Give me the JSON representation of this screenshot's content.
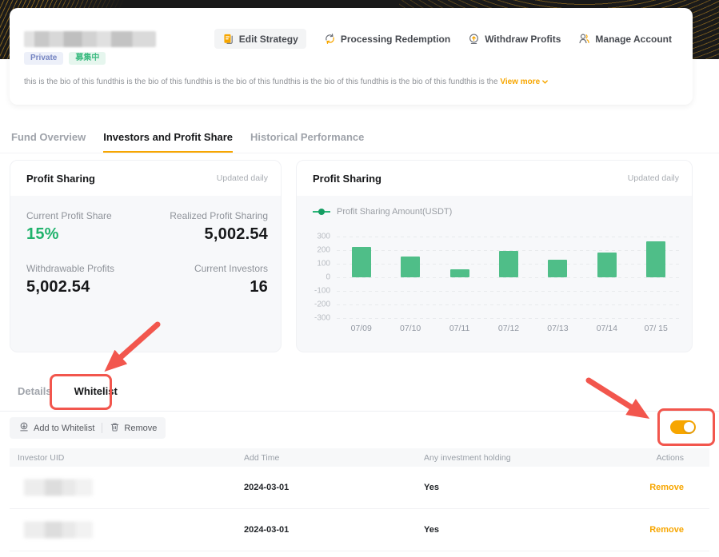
{
  "colors": {
    "accent": "#F7A600",
    "green": "#20B26C",
    "bar_green": "#4FBE88",
    "annotation_red": "#F2564D"
  },
  "header": {
    "badges": [
      {
        "label": "Private",
        "style": "blue"
      },
      {
        "label": "募集中",
        "style": "green"
      }
    ],
    "bio": "this is the bio of this fundthis is the bio of this fundthis is the bio of this fundthis is the bio of this fundthis is the bio of this fundthis is the ",
    "view_more": "View more",
    "actions": [
      {
        "label": "Edit Strategy",
        "icon": "edit-strategy-icon",
        "name": "edit-strategy",
        "pill": true
      },
      {
        "label": "Processing Redemption",
        "icon": "processing-redemption-icon",
        "name": "processing-redemption",
        "pill": false
      },
      {
        "label": "Withdraw Profits",
        "icon": "withdraw-profits-icon",
        "name": "withdraw-profits",
        "pill": false
      },
      {
        "label": "Manage Account",
        "icon": "manage-account-icon",
        "name": "manage-account",
        "pill": false
      }
    ]
  },
  "main_tabs": [
    {
      "label": "Fund Overview",
      "active": false
    },
    {
      "label": "Investors and Profit Share",
      "active": true
    },
    {
      "label": "Historical Performance",
      "active": false
    }
  ],
  "profit_panel": {
    "title": "Profit Sharing",
    "updated": "Updated daily",
    "stats": [
      {
        "label": "Current Profit Share",
        "value": "15%",
        "green": true
      },
      {
        "label": "Realized Profit Sharing",
        "value": "5,002.54",
        "green": false
      },
      {
        "label": "Withdrawable Profits",
        "value": "5,002.54",
        "green": false
      },
      {
        "label": "Current Investors",
        "value": "16",
        "green": false
      }
    ]
  },
  "chart_panel": {
    "title": "Profit Sharing",
    "updated": "Updated daily"
  },
  "chart_data": {
    "type": "bar",
    "title": "Profit Sharing",
    "legend": [
      "Profit Sharing Amount(USDT)"
    ],
    "legend_position": "top-left",
    "categories": [
      "07/09",
      "07/10",
      "07/11",
      "07/12",
      "07/13",
      "07/14",
      "07/ 15"
    ],
    "values": [
      225,
      155,
      60,
      195,
      130,
      180,
      265
    ],
    "yticks": [
      300,
      200,
      100,
      0,
      -100,
      -200,
      -300
    ],
    "ylim": [
      -300,
      300
    ],
    "grid": true,
    "bar_color": "#4FBE88"
  },
  "section_tabs": [
    {
      "label": "Details",
      "active": false
    },
    {
      "label": "Whitelist",
      "active": true
    }
  ],
  "toolbar": {
    "add_label": "Add to Whitelist",
    "remove_label": "Remove"
  },
  "whitelist_toggle": {
    "state": "on"
  },
  "table": {
    "columns": [
      "Investor UID",
      "Add Time",
      "Any investment holding",
      "Actions"
    ],
    "rows": [
      {
        "uid_redacted": true,
        "add_time": "2024-03-01",
        "holding": "Yes",
        "action": "Remove"
      },
      {
        "uid_redacted": true,
        "add_time": "2024-03-01",
        "holding": "Yes",
        "action": "Remove"
      }
    ]
  }
}
